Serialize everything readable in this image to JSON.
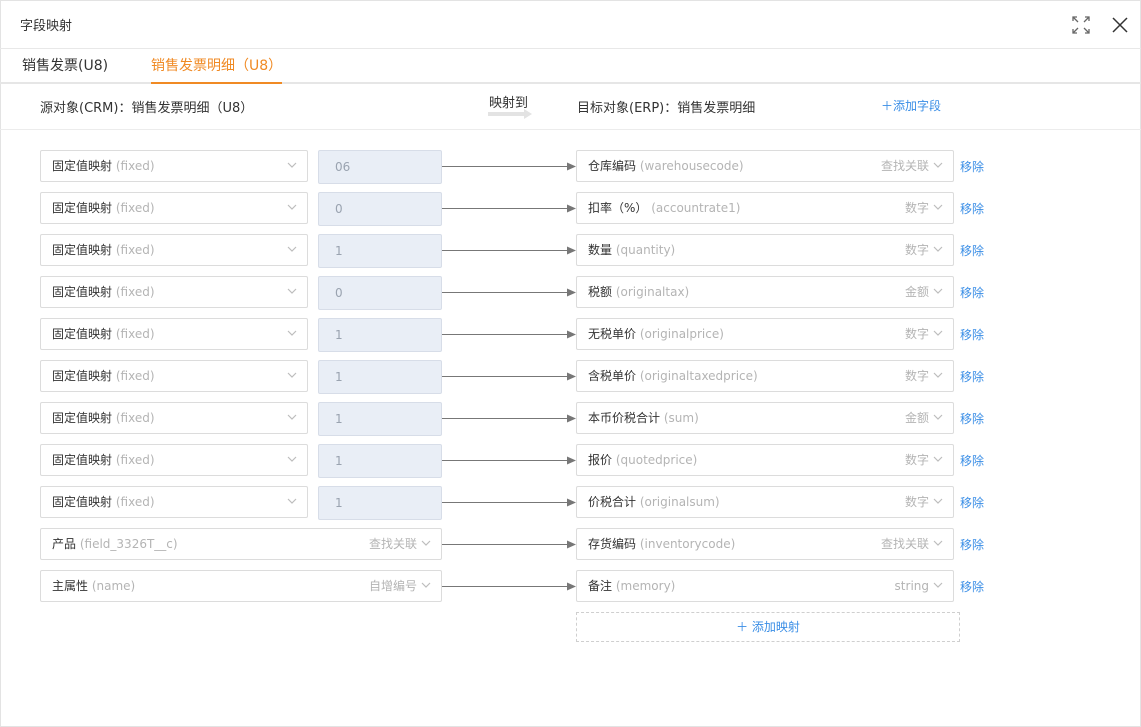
{
  "dialog": {
    "title": "字段映射"
  },
  "tabs": [
    {
      "label": "销售发票(U8)"
    },
    {
      "label": "销售发票明细（U8）"
    }
  ],
  "mapping_header": {
    "source_label": "源对象(CRM)：销售发票明细（U8）",
    "maps_to": "映射到",
    "target_label": "目标对象(ERP)：销售发票明细",
    "add_field": "添加字段"
  },
  "rows": [
    {
      "src_name": "固定值映射",
      "src_en": "(fixed)",
      "value": "06",
      "tgt_name": "仓库编码",
      "tgt_en": "(warehousecode)",
      "tgt_type": "查找关联",
      "remove": "移除"
    },
    {
      "src_name": "固定值映射",
      "src_en": "(fixed)",
      "value": "0",
      "tgt_name": "扣率（%）",
      "tgt_en": "(accountrate1)",
      "tgt_type": "数字",
      "remove": "移除"
    },
    {
      "src_name": "固定值映射",
      "src_en": "(fixed)",
      "value": "1",
      "tgt_name": "数量",
      "tgt_en": "(quantity)",
      "tgt_type": "数字",
      "remove": "移除"
    },
    {
      "src_name": "固定值映射",
      "src_en": "(fixed)",
      "value": "0",
      "tgt_name": "税额",
      "tgt_en": "(originaltax)",
      "tgt_type": "金额",
      "remove": "移除"
    },
    {
      "src_name": "固定值映射",
      "src_en": "(fixed)",
      "value": "1",
      "tgt_name": "无税单价",
      "tgt_en": "(originalprice)",
      "tgt_type": "数字",
      "remove": "移除"
    },
    {
      "src_name": "固定值映射",
      "src_en": "(fixed)",
      "value": "1",
      "tgt_name": "含税单价",
      "tgt_en": "(originaltaxedprice)",
      "tgt_type": "数字",
      "remove": "移除"
    },
    {
      "src_name": "固定值映射",
      "src_en": "(fixed)",
      "value": "1",
      "tgt_name": "本币价税合计",
      "tgt_en": "(sum)",
      "tgt_type": "金额",
      "remove": "移除"
    },
    {
      "src_name": "固定值映射",
      "src_en": "(fixed)",
      "value": "1",
      "tgt_name": "报价",
      "tgt_en": "(quotedprice)",
      "tgt_type": "数字",
      "remove": "移除"
    },
    {
      "src_name": "固定值映射",
      "src_en": "(fixed)",
      "value": "1",
      "tgt_name": "价税合计",
      "tgt_en": "(originalsum)",
      "tgt_type": "数字",
      "remove": "移除"
    },
    {
      "src_name": "产品",
      "src_en": "(field_3326T__c)",
      "src_type": "查找关联",
      "tgt_name": "存货编码",
      "tgt_en": "(inventorycode)",
      "tgt_type": "查找关联",
      "remove": "移除"
    },
    {
      "src_name": "主属性",
      "src_en": "(name)",
      "src_type": "自增编号",
      "tgt_name": "备注",
      "tgt_en": "(memory)",
      "tgt_type": "string",
      "remove": "移除"
    }
  ],
  "add_mapping": "添加映射",
  "colors": {
    "accent": "#f08a24",
    "link": "#3a8ee6",
    "value_bg": "#e9eef6"
  }
}
